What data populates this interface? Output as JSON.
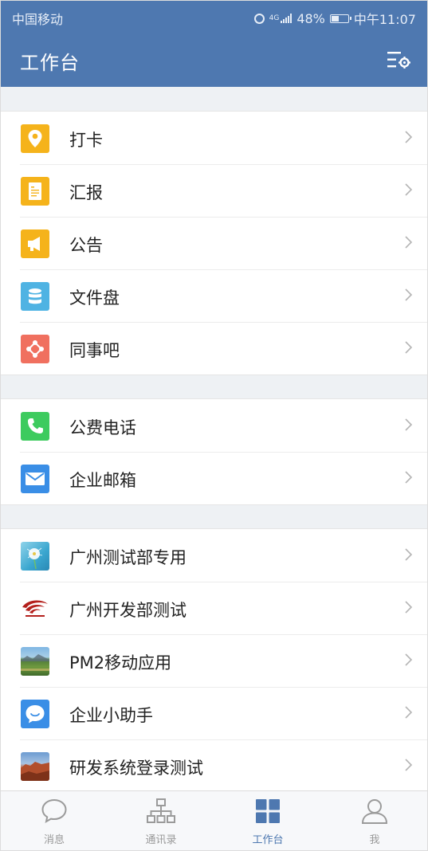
{
  "status_bar": {
    "carrier": "中国移动",
    "network": "4G",
    "battery": "48%",
    "battery_level": 0.48,
    "time": "中午11:07"
  },
  "header": {
    "title": "工作台",
    "settings_icon": "list-settings-icon"
  },
  "sections": [
    {
      "items": [
        {
          "label": "打卡",
          "icon": "location-pin-icon",
          "color": "#f5b31b"
        },
        {
          "label": "汇报",
          "icon": "document-icon",
          "color": "#f5b31b"
        },
        {
          "label": "公告",
          "icon": "megaphone-icon",
          "color": "#f5b31b"
        },
        {
          "label": "文件盘",
          "icon": "database-icon",
          "color": "#4fb3e3"
        },
        {
          "label": "同事吧",
          "icon": "share-nodes-icon",
          "color": "#f0705f"
        }
      ]
    },
    {
      "items": [
        {
          "label": "公费电话",
          "icon": "phone-icon",
          "color": "#3dcb5e"
        },
        {
          "label": "企业邮箱",
          "icon": "mail-icon",
          "color": "#3a8ee6"
        }
      ]
    },
    {
      "items": [
        {
          "label": "广州测试部专用",
          "icon": "dandelion-photo-icon"
        },
        {
          "label": "广州开发部测试",
          "icon": "red-logo-icon"
        },
        {
          "label": "PM2移动应用",
          "icon": "landscape-photo-icon"
        },
        {
          "label": "企业小助手",
          "icon": "chat-bubble-icon",
          "color": "#3a8ee6"
        },
        {
          "label": "研发系统登录测试",
          "icon": "canyon-photo-icon"
        }
      ]
    }
  ],
  "tabs": [
    {
      "label": "消息",
      "icon": "chat-icon",
      "active": false
    },
    {
      "label": "通讯录",
      "icon": "org-chart-icon",
      "active": false
    },
    {
      "label": "工作台",
      "icon": "grid-icon",
      "active": true
    },
    {
      "label": "我",
      "icon": "person-icon",
      "active": false
    }
  ],
  "colors": {
    "header": "#4e78b0",
    "active_tab": "#4e78b0",
    "inactive_tab": "#999999"
  }
}
